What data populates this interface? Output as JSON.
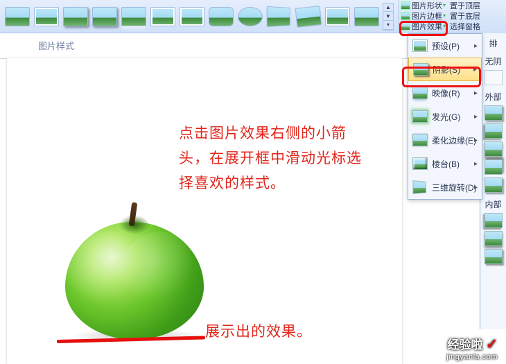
{
  "section_label": "图片样式",
  "ribbon": {
    "shape_label": "图片形状",
    "border_label": "图片边框",
    "effects_label": "图片效果",
    "bring_front": "置于顶层",
    "send_back": "置于底层",
    "selection_pane": "选择窗格",
    "alignment_label": "排"
  },
  "effects_menu": {
    "preset": "预设(P)",
    "shadow": "阴影(S)",
    "reflection": "映像(R)",
    "glow": "发光(G)",
    "soft_edges": "柔化边缘(E)",
    "bevel": "棱台(B)",
    "rotation3d": "三维旋转(D)"
  },
  "shadow_panel": {
    "no_shadow": "无阴",
    "outer": "外部",
    "inner": "内部"
  },
  "annotations": {
    "instruction": "点击图片效果右侧的小箭头，在展开框中滑动光标选择喜欢的样式。",
    "caption": "展示出的效果。"
  },
  "watermark": {
    "line1": "经验啦",
    "line2": "jingyanla.com"
  }
}
